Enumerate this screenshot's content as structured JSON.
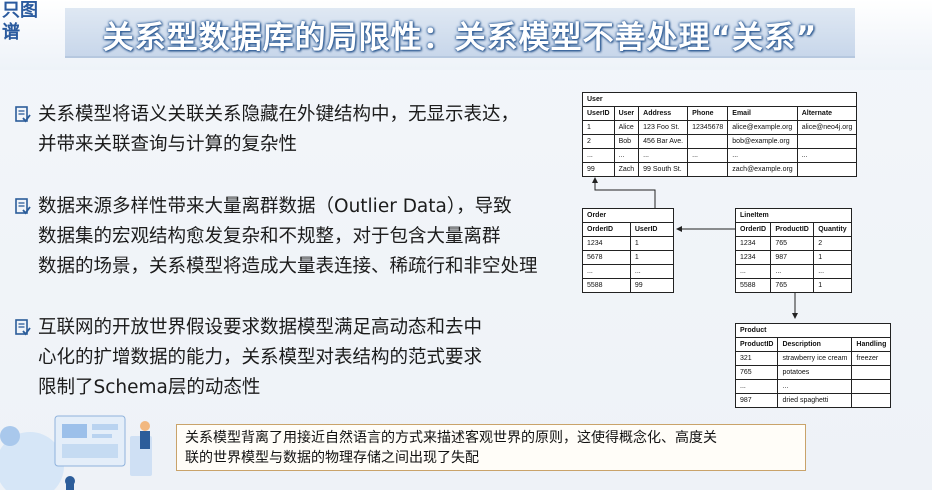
{
  "logo": {
    "line1": "只图",
    "line2": "谱"
  },
  "title": "关系型数据库的局限性：关系模型不善处理“关系”",
  "bullets": [
    {
      "line1": "关系模型将语义关联关系隐藏在外键结构中，无显示表达，",
      "line2": "并带来关联查询与计算的复杂性"
    },
    {
      "line1": "数据来源多样性带来大量离群数据（Outlier Data），导致",
      "line2": "数据集的宏观结构愈发复杂和不规整，对于包含大量离群",
      "line3": "数据的场景，关系模型将造成大量表连接、稀疏行和非空处理"
    },
    {
      "line1": "互联网的开放世界假设要求数据模型满足高动态和去中",
      "line2": "心化的扩增数据的能力，关系模型对表结构的范式要求",
      "line3": "限制了Schema层的动态性"
    }
  ],
  "tables": {
    "user": {
      "caption": "User",
      "headers": [
        "UserID",
        "User",
        "Address",
        "Phone",
        "Email",
        "Alternate"
      ],
      "rows": [
        [
          "1",
          "Alice",
          "123 Foo St.",
          "12345678",
          "alice@example.org",
          "alice@neo4j.org"
        ],
        [
          "2",
          "Bob",
          "456 Bar Ave.",
          "",
          "bob@example.org",
          ""
        ],
        [
          "...",
          "...",
          "...",
          "...",
          "...",
          "..."
        ],
        [
          "99",
          "Zach",
          "99 South St.",
          "",
          "zach@example.org",
          ""
        ]
      ]
    },
    "order": {
      "caption": "Order",
      "headers": [
        "OrderID",
        "UserID"
      ],
      "rows": [
        [
          "1234",
          "1"
        ],
        [
          "5678",
          "1"
        ],
        [
          "...",
          "..."
        ],
        [
          "5588",
          "99"
        ]
      ]
    },
    "lineitem": {
      "caption": "LineItem",
      "headers": [
        "OrderID",
        "ProductID",
        "Quantity"
      ],
      "rows": [
        [
          "1234",
          "765",
          "2"
        ],
        [
          "1234",
          "987",
          "1"
        ],
        [
          "...",
          "...",
          "..."
        ],
        [
          "5588",
          "765",
          "1"
        ]
      ]
    },
    "product": {
      "caption": "Product",
      "headers": [
        "ProductID",
        "Description",
        "Handling"
      ],
      "rows": [
        [
          "321",
          "strawberry ice cream",
          "freezer"
        ],
        [
          "765",
          "potatoes",
          ""
        ],
        [
          "...",
          "...",
          ""
        ],
        [
          "987",
          "dried spaghetti",
          ""
        ]
      ]
    }
  },
  "note": {
    "line1": "关系模型背离了用接近自然语言的方式来描述客观世界的原则，这使得概念化、高度关",
    "line2": "联的世界模型与数据的物理存储之间出现了失配"
  },
  "colors": {
    "accent": "#2c5d9a",
    "note_border": "#c9a36a"
  }
}
